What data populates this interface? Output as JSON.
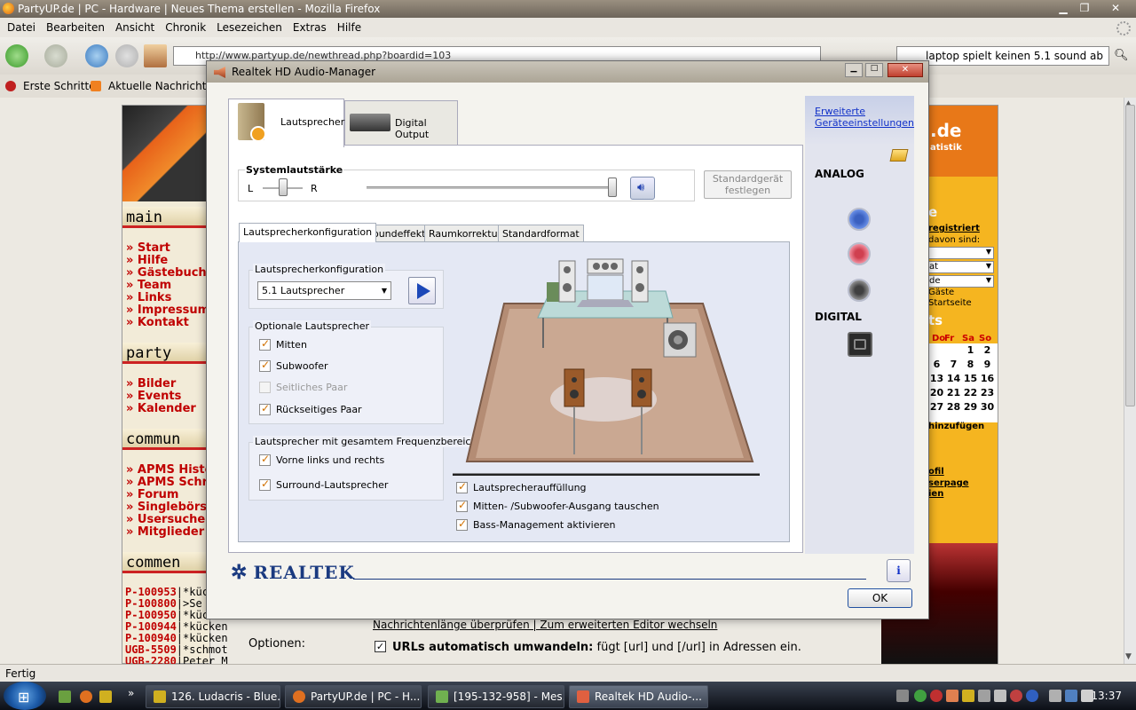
{
  "firefox": {
    "title": "PartyUP.de | PC - Hardware | Neues Thema erstellen - Mozilla Firefox",
    "menu": [
      "Datei",
      "Bearbeiten",
      "Ansicht",
      "Chronik",
      "Lesezeichen",
      "Extras",
      "Hilfe"
    ],
    "url": "http://www.partyup.de/newthread.php?boardid=103",
    "search_value": "laptop spielt keinen 5.1 sound ab",
    "bookmarks": [
      "Erste Schritte",
      "Aktuelle Nachrichten"
    ],
    "status": "Fertig"
  },
  "page": {
    "sections": {
      "main": "main",
      "party": "party",
      "community": "commun",
      "comments": "commen"
    },
    "main_links": [
      "» Start",
      "» Hilfe",
      "» Gästebuch",
      "» Team",
      "» Links",
      "» Impressum",
      "» Kontakt"
    ],
    "party_links": [
      "» Bilder",
      "» Events",
      "» Kalender"
    ],
    "community_links": [
      "» APMS Histo",
      "» APMS Schre",
      "» Forum",
      "» Singlebörse",
      "» Usersuche",
      "» Mitglieder"
    ],
    "comments": [
      {
        "code": "P-100953",
        "text": "|*kück"
      },
      {
        "code": "P-100800",
        "text": "|>Se"
      },
      {
        "code": "P-100950",
        "text": "|*kück"
      },
      {
        "code": "P-100944",
        "text": "|*kücken"
      },
      {
        "code": "P-100940",
        "text": "|*kücken"
      },
      {
        "code": "UGB-5509",
        "text": "|*schmot"
      },
      {
        "code": "UGB-2280",
        "text": "|Peter M"
      }
    ],
    "right_col": {
      "de_text": ".de",
      "statistik": "atistik",
      "e": "e",
      "registriert": "registriert",
      "davon": "davon sind:",
      "select1": "",
      "select2": "at",
      "select3": "de",
      "gaeste": "Gäste",
      "startseite": "Startseite",
      "ts": "ts",
      "days": [
        "Do",
        "Fr",
        "Sa",
        "So"
      ],
      "cal_rows": [
        [
          "",
          "",
          "1",
          "2"
        ],
        [
          "6",
          "7",
          "8",
          "9"
        ],
        [
          "13",
          "14",
          "15",
          "16"
        ],
        [
          "20",
          "21",
          "22",
          "23"
        ],
        [
          "27",
          "28",
          "29",
          "30"
        ]
      ],
      "hinzufuegen": "hinzufügen",
      "ofil": "ofil",
      "serpage": "serpage",
      "ien": "ien"
    },
    "options_label": "Optionen:",
    "nachrichten": "Nachrichtenlänge überprüfen | Zum erweiterten Editor wechseln",
    "urls_bold": "URLs automatisch umwandeln:",
    "urls_text": " fügt [url] und [/url] in Adressen ein."
  },
  "realtek": {
    "title": "Realtek HD Audio-Manager",
    "tabs": [
      "Lautsprecher",
      "Digital Output"
    ],
    "system_volume_label": "Systemlautstärke",
    "balance_left": "L",
    "balance_right": "R",
    "balance": 0.5,
    "volume": 1.0,
    "std_button": "Standardgerät festlegen",
    "subtabs": [
      "Lautsprecherkonfiguration",
      "Soundeffekt",
      "Raumkorrektur",
      "Standardformat"
    ],
    "config_label": "Lautsprecherkonfiguration",
    "config_value": "5.1 Lautsprecher",
    "optional_label": "Optionale Lautsprecher",
    "optional": [
      {
        "label": "Mitten",
        "checked": true,
        "disabled": false
      },
      {
        "label": "Subwoofer",
        "checked": true,
        "disabled": false
      },
      {
        "label": "Seitliches Paar",
        "checked": false,
        "disabled": true
      },
      {
        "label": "Rückseitiges Paar",
        "checked": true,
        "disabled": false
      }
    ],
    "fullrange_label": "Lautsprecher mit gesamtem Frequenzbereich",
    "fullrange": [
      {
        "label": "Vorne links und rechts",
        "checked": true
      },
      {
        "label": "Surround-Lautsprecher",
        "checked": true
      }
    ],
    "bottom_checks": [
      {
        "label": "Lautsprecherauffüllung",
        "checked": true
      },
      {
        "label": "Mitten- /Subwoofer-Ausgang tauschen",
        "checked": true
      },
      {
        "label": "Bass-Management aktivieren",
        "checked": true
      }
    ],
    "advanced_link": "Erweiterte Geräteeinstellungen",
    "analog_label": "ANALOG",
    "digital_label": "DIGITAL",
    "jack_colors": [
      "#4a78d8",
      "#e06070",
      "#707070"
    ],
    "brand": "REALTEK",
    "ok": "OK"
  },
  "taskbar": {
    "tasks": [
      "126. Ludacris - Blue...",
      "PartyUP.de | PC - H...",
      "[195-132-958] - Mes...",
      "Realtek HD Audio-..."
    ],
    "time": "13:37"
  }
}
